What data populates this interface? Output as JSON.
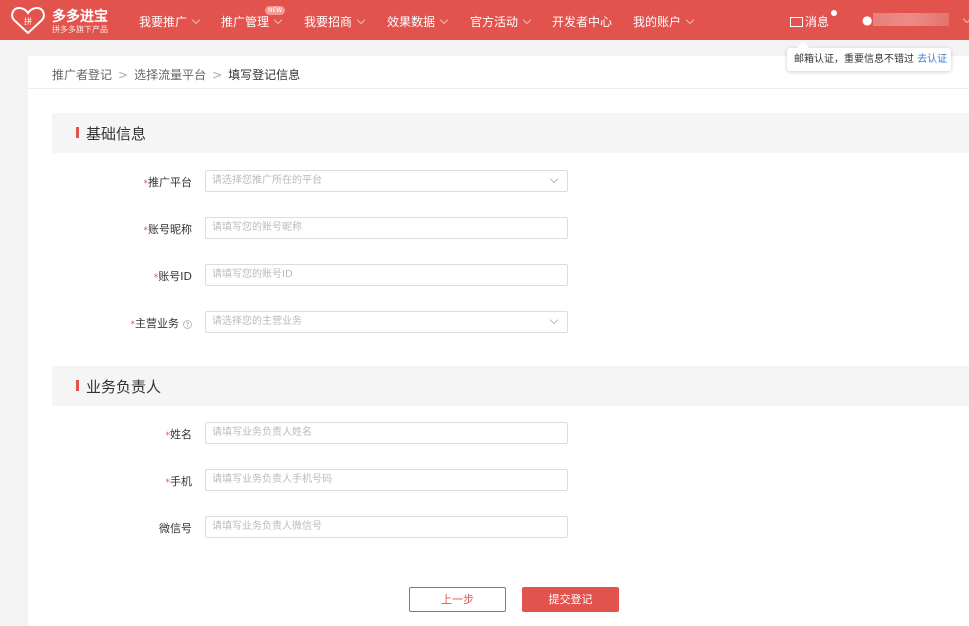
{
  "header": {
    "brand": "多多进宝",
    "brand_sub": "拼多多旗下产品",
    "nav": [
      {
        "label": "我要推广",
        "dropdown": true
      },
      {
        "label": "推广管理",
        "dropdown": true,
        "badge": "NEW"
      },
      {
        "label": "我要招商",
        "dropdown": true
      },
      {
        "label": "效果数据",
        "dropdown": true
      },
      {
        "label": "官方活动",
        "dropdown": true
      },
      {
        "label": "开发者中心",
        "dropdown": false
      },
      {
        "label": "我的账户",
        "dropdown": true
      }
    ],
    "messages": "消息",
    "accent": "#e2534d"
  },
  "tooltip": {
    "text": "邮箱认证，重要信息不错过",
    "link": "去认证"
  },
  "breadcrumb": [
    "推广者登记",
    "选择流量平台",
    "填写登记信息"
  ],
  "sections": [
    {
      "title": "基础信息",
      "fields": [
        {
          "label": "推广平台",
          "required": true,
          "type": "select",
          "placeholder": "请选择您推广所在的平台"
        },
        {
          "label": "账号昵称",
          "required": true,
          "type": "text",
          "placeholder": "请填写您的账号昵称"
        },
        {
          "label": "账号ID",
          "required": true,
          "type": "text",
          "placeholder": "请填写您的账号ID"
        },
        {
          "label": "主营业务",
          "required": true,
          "type": "select",
          "help": "?",
          "placeholder": "请选择您的主营业务"
        }
      ]
    },
    {
      "title": "业务负责人",
      "fields": [
        {
          "label": "姓名",
          "required": true,
          "type": "text",
          "placeholder": "请填写业务负责人姓名"
        },
        {
          "label": "手机",
          "required": true,
          "type": "text",
          "placeholder": "请填写业务负责人手机号码"
        },
        {
          "label": "微信号",
          "required": false,
          "type": "text",
          "placeholder": "请填写业务负责人微信号"
        }
      ]
    }
  ],
  "buttons": {
    "prev": "上一步",
    "submit": "提交登记"
  }
}
